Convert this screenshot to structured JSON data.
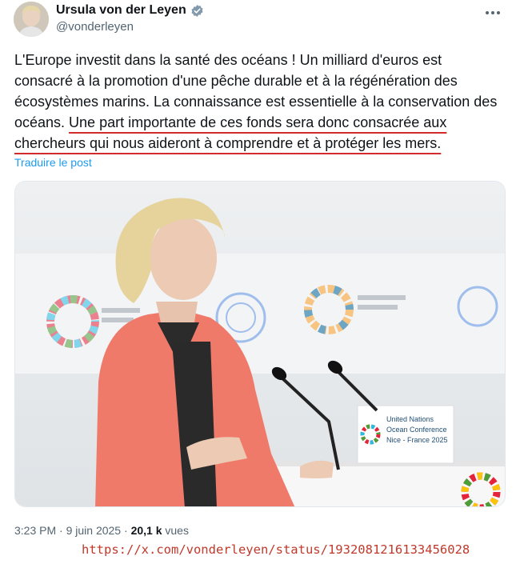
{
  "author": {
    "display_name": "Ursula von der Leyen",
    "handle": "@vonderleyen",
    "verified_icon": "verified-badge-icon",
    "more_icon": "more-icon"
  },
  "tweet": {
    "text_plain": "L'Europe investit dans la santé des océans ! Un milliard d'euros est consacré à la promotion d'une pêche durable et à la régénération des écosystèmes marins. La connaissance est essentielle à la conservation des océans. ",
    "text_highlight": "Une part importante de ces fonds sera donc consacrée aux chercheurs qui nous aideront à comprendre et à protéger les mers.",
    "translate_label": "Traduire le post"
  },
  "photo": {
    "sign_line1": "United Nations",
    "sign_line2": "Ocean Conference",
    "sign_line3": "Nice - France 2025"
  },
  "meta": {
    "time": "3:23 PM",
    "sep1": " · ",
    "date": "9 juin 2025",
    "sep2": " · ",
    "views_count": "20,1 k",
    "views_label": " vues"
  },
  "annotation": {
    "url": "https://x.com/vonderleyen/status/1932081216133456028"
  },
  "colors": {
    "link_blue": "#1d9bf0",
    "underline_red": "#d22b2b",
    "url_red": "#c0392b",
    "blazer_coral": "#f07a6a"
  }
}
